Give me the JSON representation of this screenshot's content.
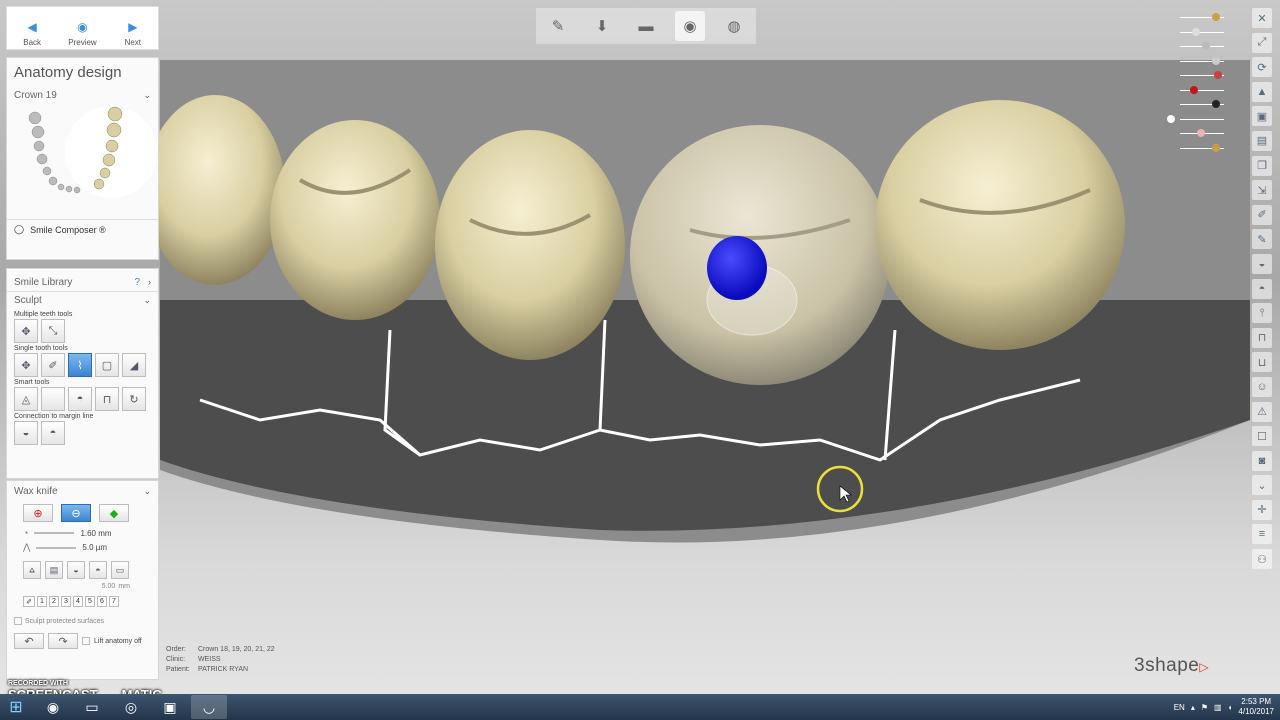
{
  "nav": {
    "back": "Back",
    "preview": "Preview",
    "next": "Next"
  },
  "panel": {
    "title": "Anatomy design",
    "crown": "Crown 19",
    "smile_composer": "Smile Composer ®"
  },
  "tools": {
    "smile_library": "Smile Library",
    "help": "?",
    "sculpt": "Sculpt",
    "multiple_teeth": "Multiple teeth tools",
    "single_tooth": "Single tooth tools",
    "smart": "Smart tools",
    "connection": "Connection to margin line"
  },
  "wax_knife": {
    "title": "Wax knife",
    "size": "1.60 mm",
    "step": "5.0 µm",
    "thickness": "5.00",
    "thickness_unit": "mm",
    "numbers": [
      "1",
      "2",
      "3",
      "4",
      "5",
      "6",
      "7"
    ],
    "protected": "Sculpt protected surfaces"
  },
  "footer": {
    "lift": "Lift anatomy off"
  },
  "info": {
    "order_label": "Order:",
    "order": "Crown 18, 19, 20, 21, 22",
    "clinic_label": "Clinic:",
    "clinic": "WEISS",
    "patient_label": "Patient:",
    "patient": "PATRICK RYAN"
  },
  "brand": {
    "logo": "3shape",
    "watermark_top": "RECORDED WITH",
    "watermark": "SCREENCAST",
    "watermark_end": "MATIC"
  },
  "taskbar": {
    "lang": "EN",
    "time": "2:53 PM",
    "date": "4/10/2017"
  },
  "colors": {
    "accent": "#3c85d2",
    "tooth": "#e4dbb3",
    "cursor_ring": "#e8e03a",
    "sculpt_ball": "#1a1ae6",
    "logo_red": "#e0321f"
  }
}
